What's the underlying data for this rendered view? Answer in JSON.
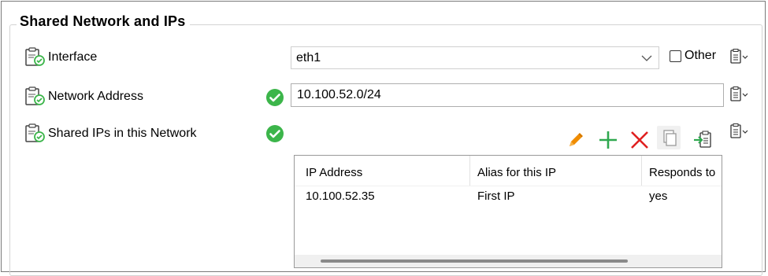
{
  "group": {
    "title": "Shared Network and IPs"
  },
  "rows": {
    "interface": {
      "label": "Interface",
      "value": "eth1",
      "other_label": "Other",
      "other_checked": false
    },
    "network_address": {
      "label": "Network Address",
      "value": "10.100.52.0/24"
    },
    "shared_ips": {
      "label": "Shared IPs in this Network"
    }
  },
  "toolbar": {
    "edit_icon": "pencil-icon",
    "add_icon": "plus-icon",
    "delete_icon": "x-icon",
    "copy_icon": "copy-icon",
    "import_icon": "import-icon"
  },
  "table": {
    "columns": [
      "IP Address",
      "Alias for this IP",
      "Responds to"
    ],
    "rows": [
      [
        "10.100.52.35",
        "First IP",
        "yes"
      ]
    ]
  },
  "colors": {
    "check_green": "#3cb54a",
    "pencil_orange": "#f08c00",
    "plus_green": "#2fa84f",
    "delete_red": "#e02020"
  }
}
